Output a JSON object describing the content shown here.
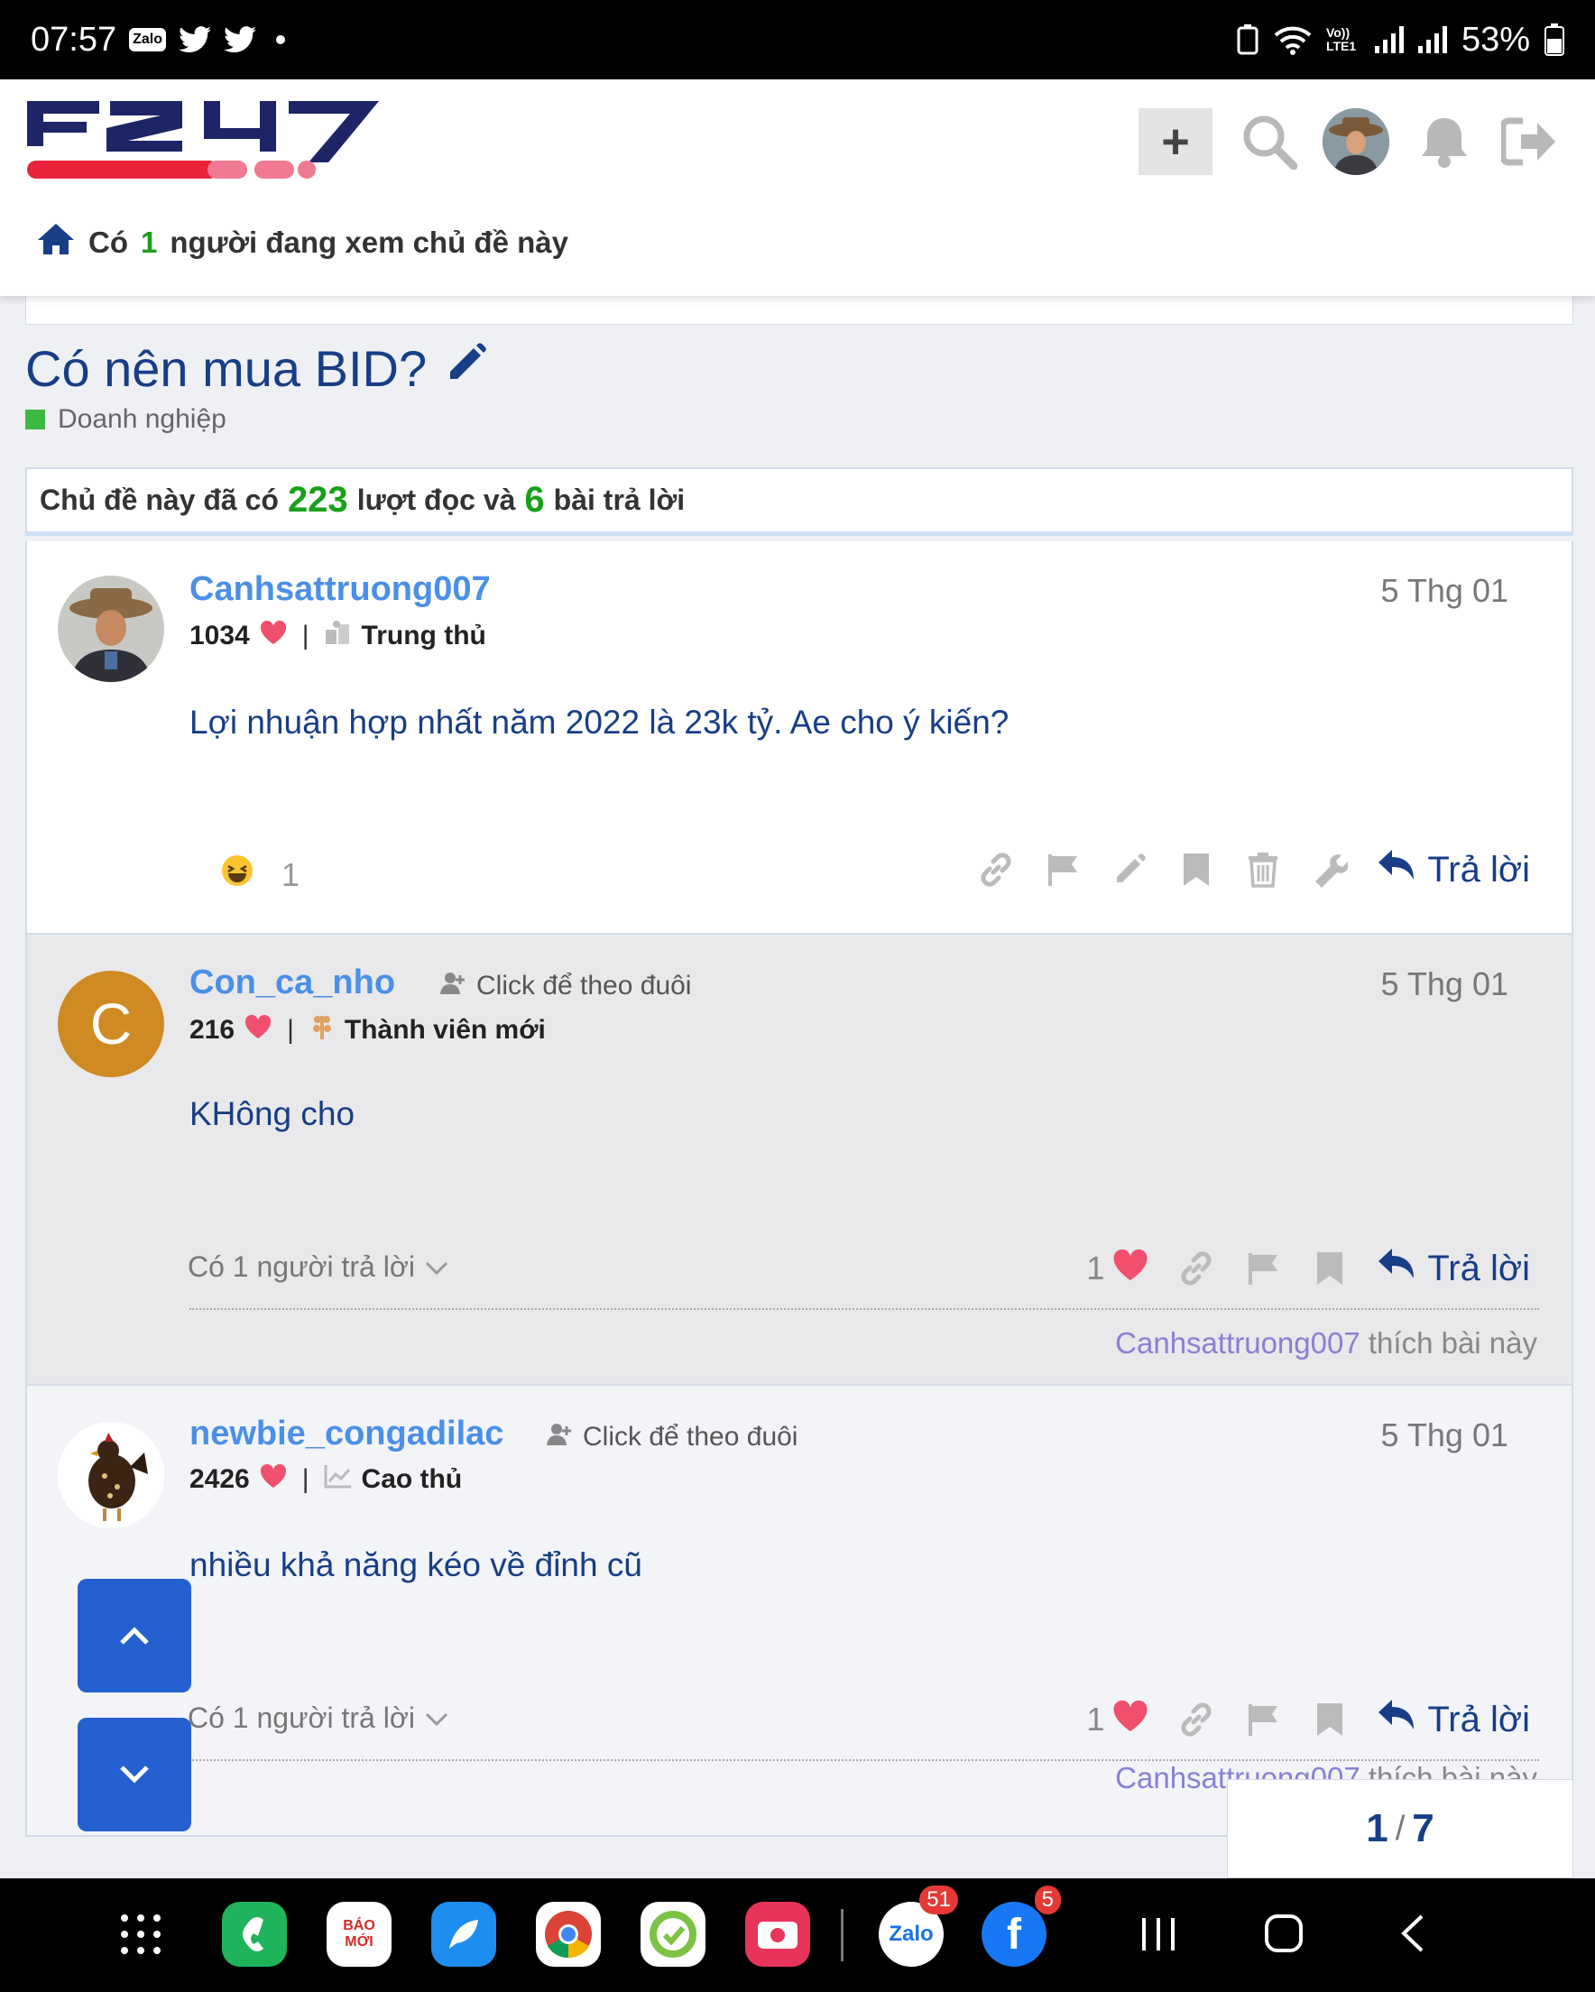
{
  "status_bar": {
    "time": "07:57",
    "zalo_label": "Zalo",
    "volte_label": "Vo)) LTE1",
    "battery": "53%"
  },
  "header": {
    "logo_text": "F247",
    "viewing_prefix": "Có",
    "viewing_count": "1",
    "viewing_suffix": "người đang xem chủ đề này"
  },
  "topic": {
    "title": "Có nên mua BID?",
    "category": "Doanh nghiệp",
    "stats_prefix": "Chủ đề này đã có",
    "views": "223",
    "stats_mid": "lượt đọc và",
    "replies": "6",
    "stats_suffix": "bài trả lời"
  },
  "posts": [
    {
      "author": "Canhsattruong007",
      "likes_received": "1034",
      "rank": "Trung thủ",
      "date": "5 Thg 01",
      "body": "Lợi nhuận hợp nhất năm 2022 là 23k tỷ. Ae cho ý kiến?",
      "reaction_count": "1",
      "reply_label": "Trả lời"
    },
    {
      "author": "Con_ca_nho",
      "avatar_letter": "C",
      "follow_label": "Click để theo đuôi",
      "likes_received": "216",
      "rank": "Thành viên mới",
      "date": "5 Thg 01",
      "body": "KHông cho",
      "replies_label": "Có 1 người trả lời",
      "like_count": "1",
      "reply_label": "Trả lời",
      "liked_user": "Canhsattruong007",
      "liked_suffix": "thích bài này"
    },
    {
      "author": "newbie_congadilac",
      "follow_label": "Click để theo đuôi",
      "likes_received": "2426",
      "rank": "Cao thủ",
      "date": "5 Thg 01",
      "body": "nhiều khả năng kéo về đỉnh cũ",
      "replies_label": "Có 1 người trả lời",
      "like_count": "1",
      "reply_label": "Trả lời",
      "liked_user": "Canhsattruong007",
      "liked_suffix": "thích bài này"
    }
  ],
  "pager": {
    "current": "1",
    "total": "7"
  },
  "nav_apps": [
    {
      "name": "Phone"
    },
    {
      "name": "Báo Mới",
      "label": "BÁO MỚI"
    },
    {
      "name": "Messages"
    },
    {
      "name": "Chrome"
    },
    {
      "name": "Clean Master"
    },
    {
      "name": "Screen Recorder"
    },
    {
      "name": "Zalo",
      "label": "Zalo",
      "badge": "51"
    },
    {
      "name": "Facebook",
      "badge": "5"
    }
  ],
  "colors": {
    "brand_navy": "#173e86",
    "link_blue": "#4a8fe8",
    "green": "#18a018",
    "scroll_btn": "#2460d0",
    "heart": "#f0506e"
  }
}
